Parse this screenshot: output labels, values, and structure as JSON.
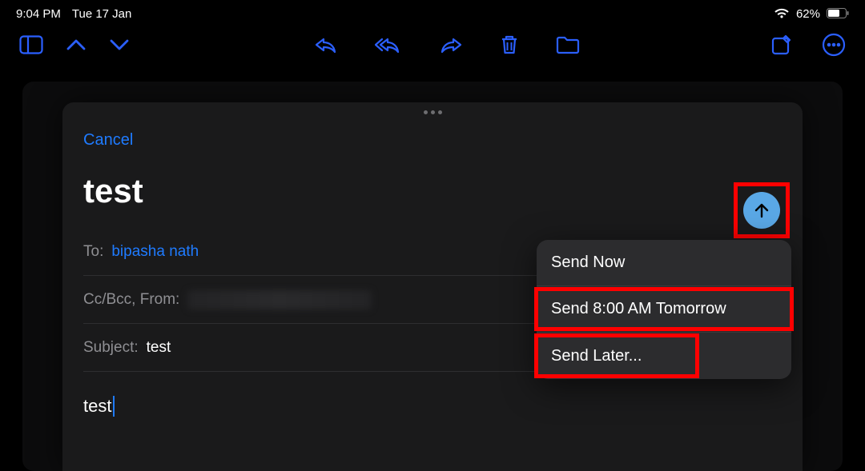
{
  "status": {
    "time": "9:04 PM",
    "date": "Tue 17 Jan",
    "battery_pct": "62%"
  },
  "toolbar": {
    "sidebar_icon": "sidebar",
    "prev_icon": "chevron-up",
    "next_icon": "chevron-down",
    "reply_icon": "reply",
    "reply_all_icon": "reply-all",
    "forward_icon": "forward",
    "delete_icon": "trash",
    "folder_icon": "folder",
    "compose_icon": "compose",
    "more_icon": "ellipsis"
  },
  "compose": {
    "cancel": "Cancel",
    "title": "test",
    "to_label": "To:",
    "to_value": "bipasha nath",
    "ccbcc_label": "Cc/Bcc, From:",
    "subject_label": "Subject:",
    "subject_value": "test",
    "body_text": "test"
  },
  "send_menu": {
    "items": [
      {
        "label": "Send Now",
        "highlight": "none"
      },
      {
        "label": "Send 8:00 AM Tomorrow",
        "highlight": "full"
      },
      {
        "label": "Send Later...",
        "highlight": "partial"
      }
    ]
  },
  "colors": {
    "accent": "#1f7bff",
    "send_bg": "#5aa8e6",
    "highlight": "#ff0000"
  }
}
